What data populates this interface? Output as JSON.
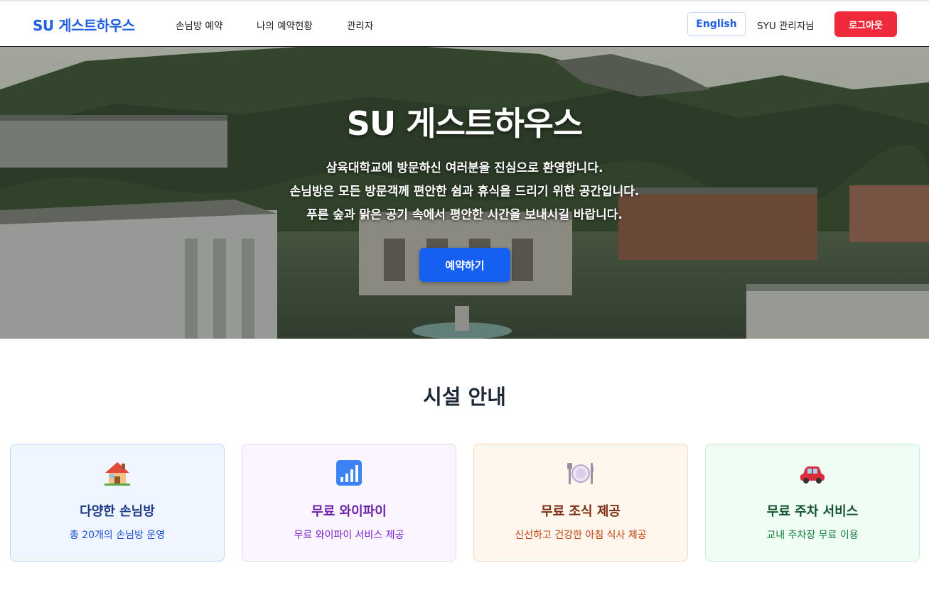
{
  "header": {
    "brand": "SU 게스트하우스",
    "nav": [
      {
        "label": "손님방 예약"
      },
      {
        "label": "나의 예약현황"
      },
      {
        "label": "관리자"
      }
    ],
    "language_button": "English",
    "user_name": "SYU 관리자님",
    "logout_button": "로그아웃"
  },
  "hero": {
    "title": "SU 게스트하우스",
    "lines": [
      "삼육대학교에 방문하신 여러분을 진심으로 환영합니다.",
      "손님방은 모든 방문객께 편안한 쉼과 휴식을 드리기 위한 공간입니다.",
      "푸른 숲과 맑은 공기 속에서 평안한 시간을 보내시길 바랍니다."
    ],
    "cta": "예약하기"
  },
  "facilities": {
    "title": "시설 안내",
    "cards": [
      {
        "icon": "house-icon",
        "title": "다양한 손님방",
        "desc": "총 20개의 손님방 운영"
      },
      {
        "icon": "signal-bars-icon",
        "title": "무료 와이파이",
        "desc": "무료 와이파이 서비스 제공"
      },
      {
        "icon": "plate-cutlery-icon",
        "title": "무료 조식 제공",
        "desc": "신선하고 건강한 아침 식사 제공"
      },
      {
        "icon": "car-icon",
        "title": "무료 주차 서비스",
        "desc": "교내 주차장 무료 이용"
      }
    ]
  },
  "colors": {
    "brand": "#1d5fe0",
    "cta": "#1560f0",
    "logout": "#ef2b3b"
  }
}
